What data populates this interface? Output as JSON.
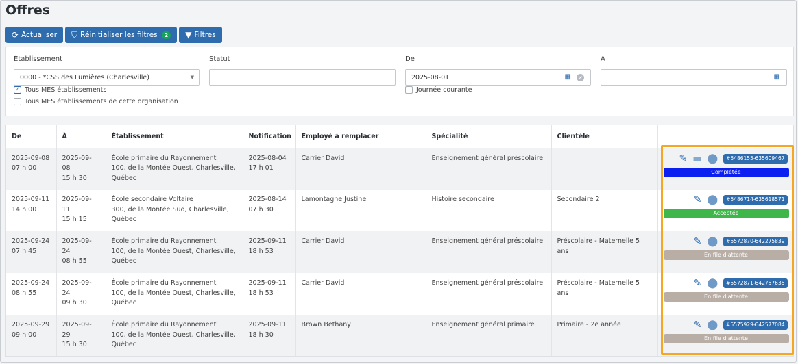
{
  "page": {
    "title": "Offres"
  },
  "toolbar": {
    "refresh_label": "Actualiser",
    "reset_label": "Réinitialiser les filtres",
    "reset_count": "2",
    "filters_label": "Filtres"
  },
  "filters": {
    "etablissement_label": "Établissement",
    "etablissement_value": "0000 - *CSS des Lumières (Charlesville)",
    "statut_label": "Statut",
    "statut_value": "",
    "de_label": "De",
    "de_value": "2025-08-01",
    "a_label": "À",
    "a_value": "",
    "tous_mes_label": "Tous MES établissements",
    "tous_mes_checked": true,
    "tous_org_label": "Tous MES établissements de cette organisation",
    "tous_org_checked": false,
    "journee_label": "Journée courante",
    "journee_checked": false
  },
  "table": {
    "headers": [
      "De",
      "À",
      "Établissement",
      "Notification",
      "Employé à remplacer",
      "Spécialité",
      "Clientèle",
      ""
    ],
    "rows": [
      {
        "de": [
          "2025-09-08",
          "07 h 00"
        ],
        "a": [
          "2025-09-08",
          "15 h 30"
        ],
        "etab": [
          "École primaire du Rayonnement",
          "100, de la Montée Ouest, Charlesville,",
          "Québec"
        ],
        "notif": [
          "2025-08-04",
          "17 h 01"
        ],
        "employe": "Carrier David",
        "specialite": "Enseignement général préscolaire",
        "clientele": "",
        "ref": "#5486155-635609467",
        "status": "Complétée",
        "status_color": "#0a1ff0",
        "has_chat": true
      },
      {
        "de": [
          "2025-09-11",
          "14 h 00"
        ],
        "a": [
          "2025-09-11",
          "15 h 15"
        ],
        "etab": [
          "École secondaire Voltaire",
          "300, de la Montée Sud, Charlesville,",
          "Québec"
        ],
        "notif": [
          "2025-08-14",
          "07 h 30"
        ],
        "employe": "Lamontagne Justine",
        "specialite": "Histoire secondaire",
        "clientele": "Secondaire 2",
        "ref": "#5486714-635618571",
        "status": "Acceptée",
        "status_color": "#3fb64a",
        "has_chat": false
      },
      {
        "de": [
          "2025-09-24",
          "07 h 45"
        ],
        "a": [
          "2025-09-24",
          "08 h 55"
        ],
        "etab": [
          "École primaire du Rayonnement",
          "100, de la Montée Ouest, Charlesville,",
          "Québec"
        ],
        "notif": [
          "2025-09-11",
          "18 h 53"
        ],
        "employe": "Carrier David",
        "specialite": "Enseignement général préscolaire",
        "clientele": "Préscolaire - Maternelle 5 ans",
        "ref": "#5572870-642275839",
        "status": "En file d'attente",
        "status_color": "#b9aea5",
        "has_chat": false
      },
      {
        "de": [
          "2025-09-24",
          "08 h 55"
        ],
        "a": [
          "2025-09-24",
          "09 h 30"
        ],
        "etab": [
          "École primaire du Rayonnement",
          "100, de la Montée Ouest, Charlesville,",
          "Québec"
        ],
        "notif": [
          "2025-09-11",
          "18 h 53"
        ],
        "employe": "Carrier David",
        "specialite": "Enseignement général préscolaire",
        "clientele": "Préscolaire - Maternelle 5 ans",
        "ref": "#5572871-642757635",
        "status": "En file d'attente",
        "status_color": "#b9aea5",
        "has_chat": false
      },
      {
        "de": [
          "2025-09-29",
          "09 h 00"
        ],
        "a": [
          "2025-09-29",
          "15 h 30"
        ],
        "etab": [
          "École primaire du Rayonnement",
          "100, de la Montée Ouest, Charlesville,",
          "Québec"
        ],
        "notif": [
          "2025-09-11",
          "18 h 30"
        ],
        "employe": "Brown Bethany",
        "specialite": "Enseignement général primaire",
        "clientele": "Primaire - 2e année",
        "ref": "#5575929-642577084",
        "status": "En file d'attente",
        "status_color": "#b9aea5",
        "has_chat": false
      }
    ]
  },
  "colors": {
    "accent": "#2f6cad",
    "highlight": "#f5a623"
  },
  "icons": [
    "refresh-icon",
    "reset-filter-icon",
    "filter-icon",
    "calendar-icon",
    "clear-icon",
    "edit-icon",
    "chat-icon",
    "map-pin-icon",
    "checkmark-icon"
  ]
}
